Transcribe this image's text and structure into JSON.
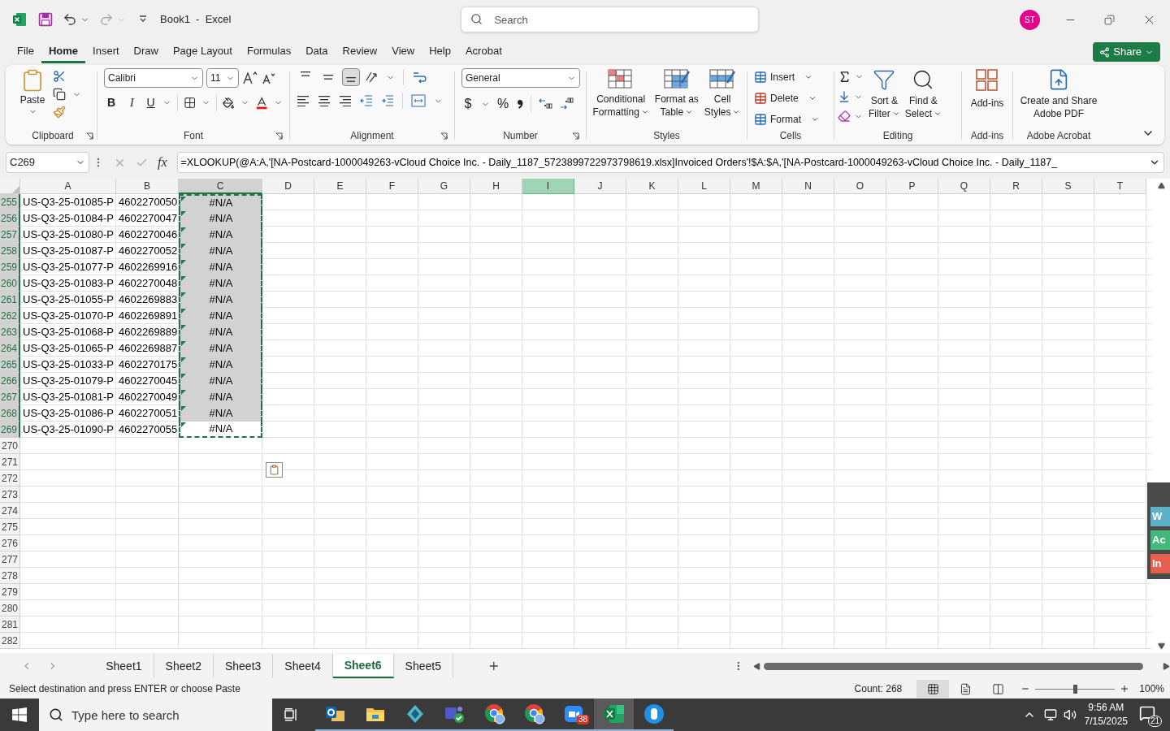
{
  "title_bar": {
    "title": "Book1  -  Excel",
    "search": {
      "placeholder": "Search"
    },
    "avatar": "ST"
  },
  "menu_tabs": [
    {
      "label": "File",
      "selected": false
    },
    {
      "label": "Home",
      "selected": true
    },
    {
      "label": "Insert",
      "selected": false
    },
    {
      "label": "Draw",
      "selected": false
    },
    {
      "label": "Page Layout",
      "selected": false
    },
    {
      "label": "Formulas",
      "selected": false
    },
    {
      "label": "Data",
      "selected": false
    },
    {
      "label": "Review",
      "selected": false
    },
    {
      "label": "View",
      "selected": false
    },
    {
      "label": "Help",
      "selected": false
    },
    {
      "label": "Acrobat",
      "selected": false
    }
  ],
  "share_button": "Share",
  "ribbon": {
    "clipboard": {
      "label": "Clipboard",
      "paste": "Paste"
    },
    "font": {
      "label": "Font",
      "font_name": "Calibri",
      "font_size": "11",
      "bold": "B",
      "italic": "I",
      "underline": "U"
    },
    "alignment": {
      "label": "Alignment",
      "vertical": [
        {
          "selected": false
        },
        {
          "selected": false
        },
        {
          "selected": true
        }
      ]
    },
    "number": {
      "label": "Number",
      "format": "General",
      "currency": "$",
      "percent": "%"
    },
    "styles": {
      "label": "Styles",
      "items": [
        [
          "Conditional",
          "Formatting"
        ],
        [
          "Format as",
          "Table"
        ],
        [
          "Cell",
          "Styles"
        ]
      ]
    },
    "cells": {
      "label": "Cells",
      "items": [
        "Insert",
        "Delete",
        "Format"
      ]
    },
    "editing": {
      "label": "Editing",
      "items": [
        [
          "Sort &",
          "Filter"
        ],
        [
          "Find &",
          "Select"
        ]
      ]
    },
    "addins": {
      "label": "Add-ins",
      "button": "Add-ins"
    },
    "acrobat": {
      "label": "Adobe Acrobat",
      "button": [
        "Create and Share",
        "Adobe PDF"
      ]
    }
  },
  "formula_bar": {
    "name_box": "C269",
    "fx": "fx",
    "formula": "=XLOOKUP(@A:A,'[NA-Postcard-1000049263-vCloud Choice Inc. - Daily_1187_5723899722973798619.xlsx]Invoiced Orders'!$A:$A,'[NA-Postcard-1000049263-vCloud Choice Inc. - Daily_1187_"
  },
  "columns": [
    {
      "label": "A",
      "selected": false,
      "hovered": false
    },
    {
      "label": "B",
      "selected": false,
      "hovered": false
    },
    {
      "label": "C",
      "selected": true,
      "hovered": false
    },
    {
      "label": "D",
      "selected": false,
      "hovered": false
    },
    {
      "label": "E",
      "selected": false,
      "hovered": false
    },
    {
      "label": "F",
      "selected": false,
      "hovered": false
    },
    {
      "label": "G",
      "selected": false,
      "hovered": false
    },
    {
      "label": "H",
      "selected": false,
      "hovered": false
    },
    {
      "label": "I",
      "selected": false,
      "hovered": true
    },
    {
      "label": "J",
      "selected": false,
      "hovered": false
    },
    {
      "label": "K",
      "selected": false,
      "hovered": false
    },
    {
      "label": "L",
      "selected": false,
      "hovered": false
    },
    {
      "label": "M",
      "selected": false,
      "hovered": false
    },
    {
      "label": "N",
      "selected": false,
      "hovered": false
    },
    {
      "label": "O",
      "selected": false,
      "hovered": false
    },
    {
      "label": "P",
      "selected": false,
      "hovered": false
    },
    {
      "label": "Q",
      "selected": false,
      "hovered": false
    },
    {
      "label": "R",
      "selected": false,
      "hovered": false
    },
    {
      "label": "S",
      "selected": false,
      "hovered": false
    },
    {
      "label": "T",
      "selected": false,
      "hovered": false
    }
  ],
  "rows": [
    {
      "number": "255",
      "selected": true,
      "active": false,
      "cells": [
        "US-Q3-25-01085-P",
        "4602270050",
        "#N/A"
      ]
    },
    {
      "number": "256",
      "selected": true,
      "active": false,
      "cells": [
        "US-Q3-25-01084-P",
        "4602270047",
        "#N/A"
      ]
    },
    {
      "number": "257",
      "selected": true,
      "active": false,
      "cells": [
        "US-Q3-25-01080-P",
        "4602270046",
        "#N/A"
      ]
    },
    {
      "number": "258",
      "selected": true,
      "active": false,
      "cells": [
        "US-Q3-25-01087-P",
        "4602270052",
        "#N/A"
      ]
    },
    {
      "number": "259",
      "selected": true,
      "active": false,
      "cells": [
        "US-Q3-25-01077-P",
        "4602269916",
        "#N/A"
      ]
    },
    {
      "number": "260",
      "selected": true,
      "active": false,
      "cells": [
        "US-Q3-25-01083-P",
        "4602270048",
        "#N/A"
      ]
    },
    {
      "number": "261",
      "selected": true,
      "active": false,
      "cells": [
        "US-Q3-25-01055-P",
        "4602269883",
        "#N/A"
      ]
    },
    {
      "number": "262",
      "selected": true,
      "active": false,
      "cells": [
        "US-Q3-25-01070-P",
        "4602269891",
        "#N/A"
      ]
    },
    {
      "number": "263",
      "selected": true,
      "active": false,
      "cells": [
        "US-Q3-25-01068-P",
        "4602269889",
        "#N/A"
      ]
    },
    {
      "number": "264",
      "selected": true,
      "active": false,
      "cells": [
        "US-Q3-25-01065-P",
        "4602269887",
        "#N/A"
      ]
    },
    {
      "number": "265",
      "selected": true,
      "active": false,
      "cells": [
        "US-Q3-25-01033-P",
        "4602270175",
        "#N/A"
      ]
    },
    {
      "number": "266",
      "selected": true,
      "active": false,
      "cells": [
        "US-Q3-25-01079-P",
        "4602270045",
        "#N/A"
      ]
    },
    {
      "number": "267",
      "selected": true,
      "active": false,
      "cells": [
        "US-Q3-25-01081-P",
        "4602270049",
        "#N/A"
      ]
    },
    {
      "number": "268",
      "selected": true,
      "active": false,
      "cells": [
        "US-Q3-25-01086-P",
        "4602270051",
        "#N/A"
      ]
    },
    {
      "number": "269",
      "selected": true,
      "active": true,
      "cells": [
        "US-Q3-25-01090-P",
        "4602270055",
        "#N/A"
      ]
    },
    {
      "number": "270",
      "selected": false,
      "active": false
    },
    {
      "number": "271",
      "selected": false,
      "active": false
    },
    {
      "number": "272",
      "selected": false,
      "active": false
    },
    {
      "number": "273",
      "selected": false,
      "active": false
    },
    {
      "number": "274",
      "selected": false,
      "active": false
    },
    {
      "number": "275",
      "selected": false,
      "active": false
    },
    {
      "number": "276",
      "selected": false,
      "active": false
    },
    {
      "number": "277",
      "selected": false,
      "active": false
    },
    {
      "number": "278",
      "selected": false,
      "active": false
    },
    {
      "number": "279",
      "selected": false,
      "active": false
    },
    {
      "number": "280",
      "selected": false,
      "active": false
    },
    {
      "number": "281",
      "selected": false,
      "active": false
    },
    {
      "number": "282",
      "selected": false,
      "active": false
    }
  ],
  "side_panel": [
    {
      "label": "W",
      "color": "#5fb0c6"
    },
    {
      "label": "Ac",
      "color": "#40b97a"
    },
    {
      "label": "In",
      "color": "#e3604f"
    }
  ],
  "sheet_tabs": [
    {
      "label": "Sheet1",
      "selected": false
    },
    {
      "label": "Sheet2",
      "selected": false
    },
    {
      "label": "Sheet3",
      "selected": false
    },
    {
      "label": "Sheet4",
      "selected": false
    },
    {
      "label": "Sheet6",
      "selected": true
    },
    {
      "label": "Sheet5",
      "selected": false
    }
  ],
  "status_bar": {
    "message": "Select destination and press ENTER or choose Paste",
    "count": "Count: 268",
    "views": [
      {
        "selected": true
      },
      {
        "selected": false
      },
      {
        "selected": false
      }
    ],
    "zoom": {
      "level": 0.5,
      "reading": "100%"
    }
  },
  "taskbar": {
    "search_placeholder": "Type here to search",
    "apps": [
      {
        "kind": "mail",
        "active": false
      },
      {
        "kind": "folder",
        "active": false
      },
      {
        "kind": "diamond",
        "active": false
      },
      {
        "kind": "chat",
        "active": false
      },
      {
        "kind": "browser",
        "active": false
      },
      {
        "kind": "browser",
        "active": false
      },
      {
        "kind": "video",
        "active": false,
        "badge": "38"
      },
      {
        "kind": "spreadsheet",
        "active": true
      },
      {
        "kind": "mouse",
        "active": false
      }
    ],
    "time": "9:56 AM",
    "date": "7/15/2025",
    "notifications": "21"
  }
}
